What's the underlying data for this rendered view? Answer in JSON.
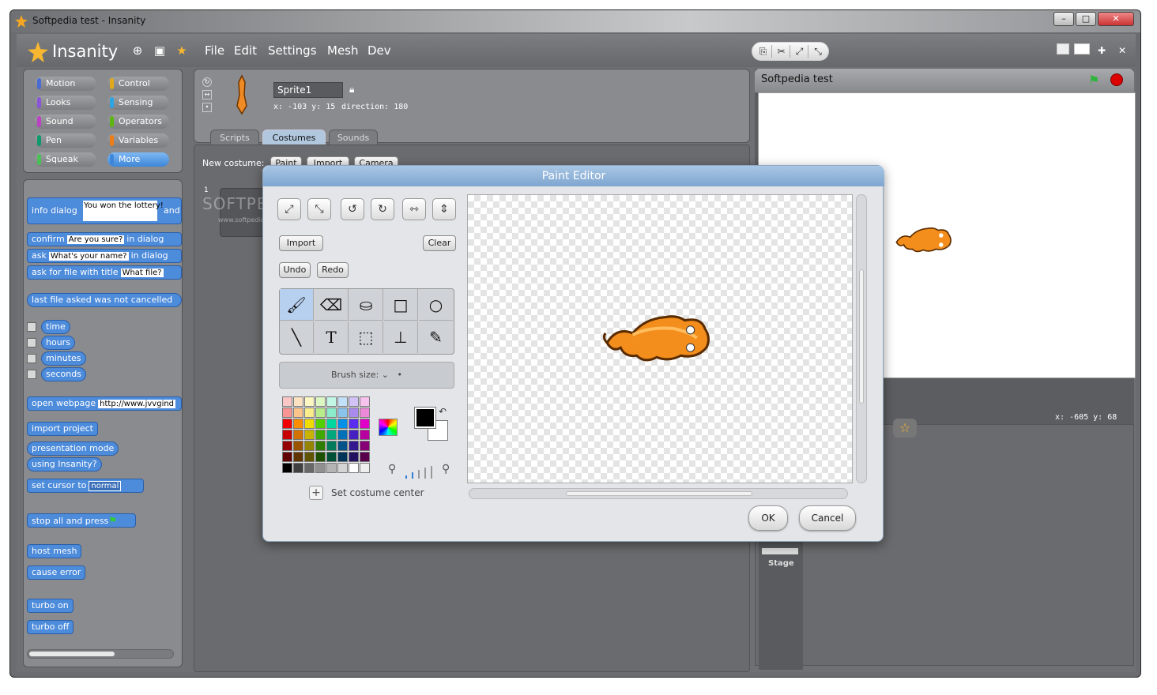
{
  "window": {
    "title": "Softpedia test - Insanity",
    "buttons": [
      "–",
      "□",
      "✕"
    ]
  },
  "app": {
    "logo": "Insanity",
    "menus": [
      "File",
      "Edit",
      "Settings",
      "Mesh",
      "Dev"
    ]
  },
  "categories": [
    {
      "label": "Motion",
      "color": "#4a6cd4"
    },
    {
      "label": "Control",
      "color": "#e1a91a"
    },
    {
      "label": "Looks",
      "color": "#8a55d7"
    },
    {
      "label": "Sensing",
      "color": "#2ca5e2"
    },
    {
      "label": "Sound",
      "color": "#bb42c3"
    },
    {
      "label": "Operators",
      "color": "#5cb712"
    },
    {
      "label": "Pen",
      "color": "#0e9a6c"
    },
    {
      "label": "Variables",
      "color": "#ee7d16"
    },
    {
      "label": "Squeak",
      "color": "#4cbf56"
    },
    {
      "label": "More",
      "color": "#3d86d9"
    }
  ],
  "blocks": {
    "info_dialog": "info dialog",
    "info_text": "You won the lottery!",
    "and": "and",
    "confirm": "confirm",
    "confirm_text": "Are you sure?",
    "in_dialog": "in dialog",
    "ask": "ask",
    "ask_text": "What's your name?",
    "ask_file": "ask for file with title",
    "ask_file_text": "What file?",
    "last_file": "last file asked was not cancelled",
    "time": "time",
    "hours": "hours",
    "minutes": "minutes",
    "seconds": "seconds",
    "open_webpage": "open webpage",
    "url": "http://www.jvvgind",
    "import_project": "import project",
    "presentation": "presentation mode",
    "using": "using Insanity?",
    "set_cursor": "set cursor to",
    "cursor_value": "normal",
    "stop_all": "stop all and press",
    "host_mesh": "host mesh",
    "cause_error": "cause error",
    "turbo_on": "turbo on",
    "turbo_off": "turbo off"
  },
  "sprite": {
    "name": "Sprite1",
    "coords": "x: -103 y: 15",
    "direction": "direction: 180",
    "tabs": [
      "Scripts",
      "Costumes",
      "Sounds"
    ],
    "new_costume": "New costume:",
    "new_buttons": [
      "Paint",
      "Import",
      "Camera"
    ],
    "costume_index": "1"
  },
  "stage": {
    "title": "Softpedia test",
    "readout": "x: -605  y: 68",
    "thumb_label": "Stage"
  },
  "watermark": {
    "text": "SOFTPEDIA",
    "url": "www.softpedia.com"
  },
  "paint": {
    "title": "Paint Editor",
    "import": "Import",
    "clear": "Clear",
    "undo": "Undo",
    "redo": "Redo",
    "brush_size": "Brush size:",
    "set_center": "Set costume center",
    "ok": "OK",
    "cancel": "Cancel",
    "palette": [
      "#fbc6c6",
      "#fde2c2",
      "#fdf7c2",
      "#dcf7c2",
      "#c2f7e6",
      "#c2e0f7",
      "#d2c2f7",
      "#f7c2ee",
      "#f89494",
      "#fbc48a",
      "#f9ec8a",
      "#b8ec8a",
      "#8aeccb",
      "#8ac3ec",
      "#aa8aec",
      "#ec8ad9",
      "#f00000",
      "#fa8e00",
      "#f0dc00",
      "#54d000",
      "#00d8a0",
      "#0090e8",
      "#5a2cf0",
      "#e000c8",
      "#c80000",
      "#d27200",
      "#c8b400",
      "#40a800",
      "#00a87c",
      "#0070b8",
      "#4620c0",
      "#b800a0",
      "#940000",
      "#9a5400",
      "#948400",
      "#2e7c00",
      "#007c5a",
      "#005288",
      "#341890",
      "#880076",
      "#600000",
      "#603400",
      "#605400",
      "#1c5000",
      "#005038",
      "#003458",
      "#221060",
      "#58004c",
      "#000000",
      "#404040",
      "#686868",
      "#909090",
      "#b4b4b4",
      "#d4d4d4",
      "#ffffff",
      "#eeeeee"
    ]
  }
}
